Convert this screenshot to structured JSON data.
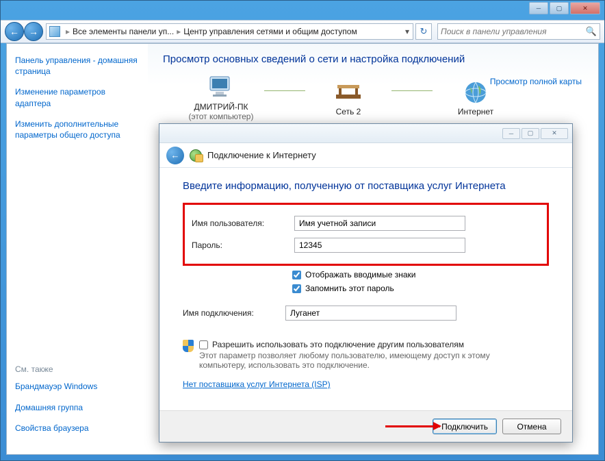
{
  "window": {
    "breadcrumb1": "Все элементы панели уп...",
    "breadcrumb2": "Центр управления сетями и общим доступом",
    "search_placeholder": "Поиск в панели управления"
  },
  "sidebar": {
    "home": "Панель управления - домашняя страница",
    "link1": "Изменение параметров адаптера",
    "link2": "Изменить дополнительные параметры общего доступа",
    "see_also_title": "См. также",
    "see1": "Брандмауэр Windows",
    "see2": "Домашняя группа",
    "see3": "Свойства браузера"
  },
  "main": {
    "title": "Просмотр основных сведений о сети и настройка подключений",
    "node1": "ДМИТРИЙ-ПК",
    "node1_sub": "(этот компьютер)",
    "node2": "Сеть 2",
    "node3": "Интернет",
    "full_map": "Просмотр полной карты"
  },
  "dialog": {
    "title": "Подключение к Интернету",
    "heading": "Введите информацию, полученную от поставщика услуг Интернета",
    "username_label": "Имя пользователя:",
    "username_value": "Имя учетной записи",
    "password_label": "Пароль:",
    "password_value": "12345",
    "show_chars": "Отображать вводимые знаки",
    "remember": "Запомнить этот пароль",
    "conn_name_label": "Имя подключения:",
    "conn_name_value": "Луганет",
    "allow_others": "Разрешить использовать это подключение другим пользователям",
    "allow_desc": "Этот параметр позволяет любому пользователю, имеющему доступ к этому компьютеру, использовать это подключение.",
    "isp_link": "Нет поставщика услуг Интернета (ISP)",
    "connect_btn": "Подключить",
    "cancel_btn": "Отмена"
  }
}
